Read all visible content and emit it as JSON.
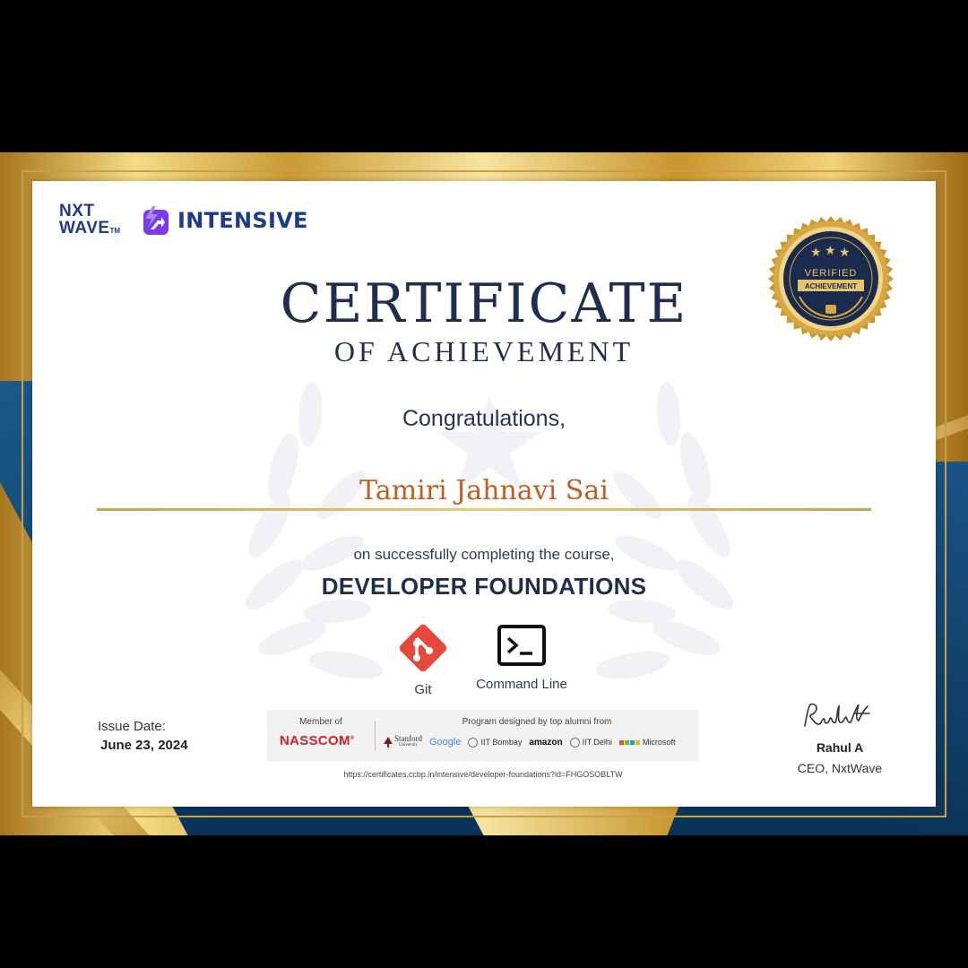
{
  "header": {
    "logo_nxt_line1": "NXT",
    "logo_nxt_line2": "WAVE",
    "logo_tm": "TM",
    "logo_intensive": "INTENSIVE"
  },
  "badge": {
    "line1": "VERIFIED",
    "line2": "ACHIEVEMENT"
  },
  "certificate": {
    "title": "CERTIFICATE",
    "subtitle": "OF ACHIEVEMENT",
    "greeting": "Congratulations,",
    "recipient": "Tamiri Jahnavi Sai",
    "completion_text": "on successfully completing the course,",
    "course": "DEVELOPER FOUNDATIONS"
  },
  "tools": [
    {
      "label": "Git",
      "icon": "git-icon"
    },
    {
      "label": "Command Line",
      "icon": "terminal-icon"
    }
  ],
  "issue": {
    "label": "Issue Date:",
    "date": "June 23, 2024"
  },
  "partners": {
    "member_label": "Member of",
    "member_name": "NASSCOM",
    "program_label": "Program designed by top alumni from",
    "logos": [
      "Stanford",
      "Google",
      "IIT Bombay",
      "amazon",
      "IIT Delhi",
      "Microsoft"
    ],
    "stanford_sub": "University"
  },
  "url": "https://certificates.ccbp.in/intensive/developer-foundations?id=FHGOSOBLTW",
  "signatory": {
    "name": "Rahul A",
    "role": "CEO, NxtWave"
  },
  "colors": {
    "navy": "#1f2e4e",
    "brand_blue": "#1e3a8a",
    "name_orange": "#c25e1d",
    "gold": "#caa14f",
    "git_red": "#e8473c",
    "intensive_purple": "#7c3aed"
  }
}
